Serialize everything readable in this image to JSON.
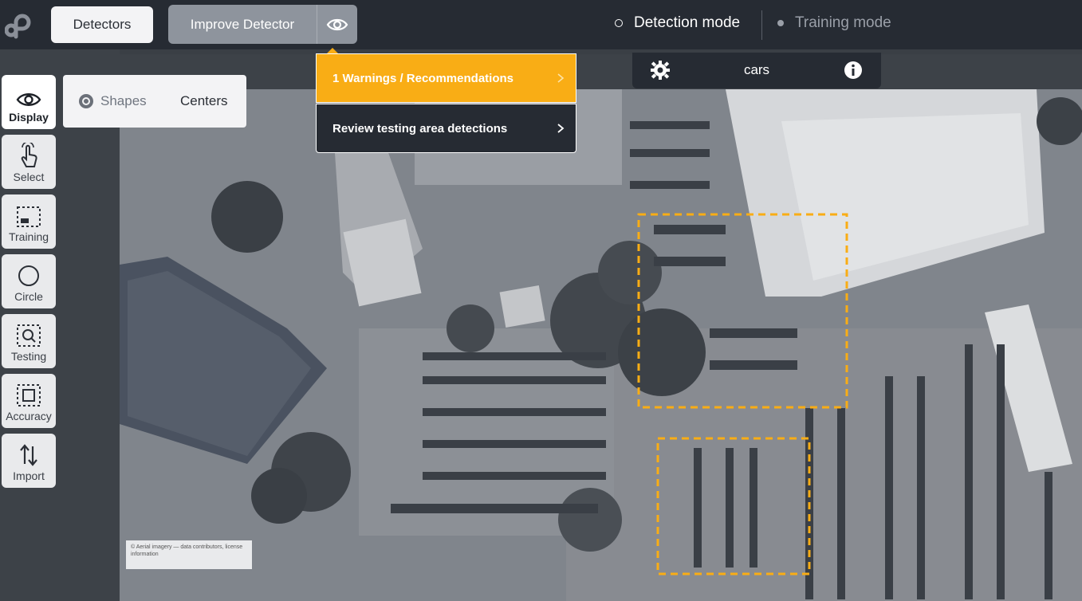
{
  "topbar": {
    "detectors_label": "Detectors",
    "improve_label": "Improve Detector",
    "mode_detection": "Detection mode",
    "mode_training": "Training mode"
  },
  "detector": {
    "name": "cars"
  },
  "dropdown": {
    "warnings_label": "1 Warnings / Recommendations",
    "review_label": "Review testing area detections"
  },
  "display_options": {
    "shapes": "Shapes",
    "centers": "Centers"
  },
  "tools": [
    {
      "label": "Display",
      "icon": "eye-icon"
    },
    {
      "label": "Select",
      "icon": "hand-pointer-icon"
    },
    {
      "label": "Training",
      "icon": "training-area-icon"
    },
    {
      "label": "Circle",
      "icon": "circle-icon"
    },
    {
      "label": "Testing",
      "icon": "testing-area-icon"
    },
    {
      "label": "Accuracy",
      "icon": "accuracy-area-icon"
    },
    {
      "label": "Import",
      "icon": "import-arrows-icon"
    }
  ],
  "map": {
    "caption": "© Aerial imagery — data contributors, license information"
  },
  "colors": {
    "topbar": "#262b33",
    "accent": "#f9ad15",
    "button_gray": "#8e949d"
  }
}
